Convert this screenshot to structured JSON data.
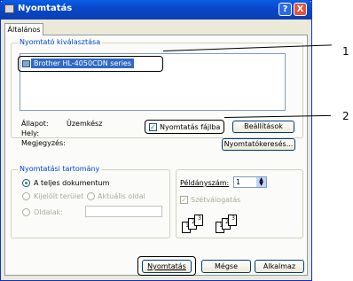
{
  "window": {
    "title": "Nyomtatás",
    "help_btn": "?",
    "close_btn": "X"
  },
  "tabs": [
    "Általános"
  ],
  "printer_group": {
    "legend": "Nyomtató kiválasztása",
    "selected_printer": "Brother HL-4050CDN series",
    "status_label": "Állapot:",
    "status_value": "Üzemkész",
    "location_label": "Hely:",
    "comment_label": "Megjegyzés:",
    "print_to_file": "Nyomtatás fájlba",
    "preferences_btn": "Beállítások",
    "find_printer_btn": "Nyomtatókeresés..."
  },
  "range_group": {
    "legend": "Nyomtatási tartomány",
    "all": "A teljes dokumentum",
    "selection": "Kijelölt terület",
    "current_page": "Aktuális oldal",
    "pages": "Oldalak:"
  },
  "copies": {
    "label": "Példányszám:",
    "value": "1",
    "collate": "Szétválogatás"
  },
  "buttons": {
    "print": "Nyomtatás",
    "cancel": "Mégse",
    "apply": "Alkalmaz"
  },
  "callouts": {
    "one": "1",
    "two": "2"
  }
}
